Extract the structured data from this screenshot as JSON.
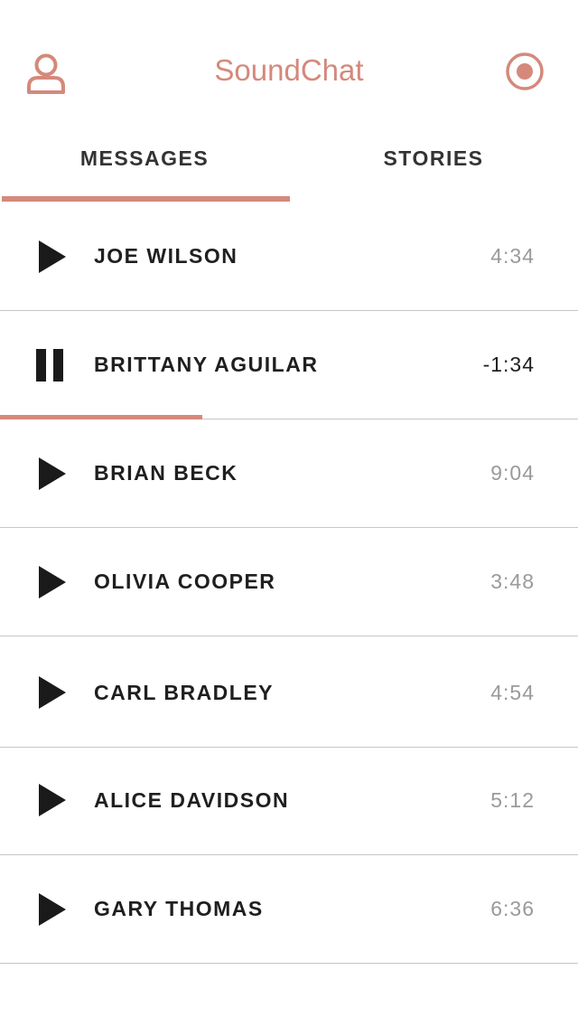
{
  "app": {
    "title": "SoundChat",
    "accent_color": "#d4897b",
    "left_icon": "user-profile-icon",
    "right_icon": "record-icon"
  },
  "tabs": [
    {
      "label": "MESSAGES",
      "selected": true
    },
    {
      "label": "STORIES",
      "selected": false
    }
  ],
  "messages": [
    {
      "name": "JOE WILSON",
      "time": "4:34",
      "state": "play-icon"
    },
    {
      "name": "BRITTANY AGUILAR",
      "time": "-1:34",
      "state": "pause-icon",
      "playing": true,
      "progress_percent": 35
    },
    {
      "name": "BRIAN BECK",
      "time": "9:04",
      "state": "play-icon"
    },
    {
      "name": "OLIVIA COOPER",
      "time": "3:48",
      "state": "play-icon"
    },
    {
      "name": "CARL BRADLEY",
      "time": "4:54",
      "state": "play-icon"
    },
    {
      "name": "ALICE DAVIDSON",
      "time": "5:12",
      "state": "play-icon"
    },
    {
      "name": "GARY THOMAS",
      "time": "6:36",
      "state": "play-icon"
    }
  ]
}
